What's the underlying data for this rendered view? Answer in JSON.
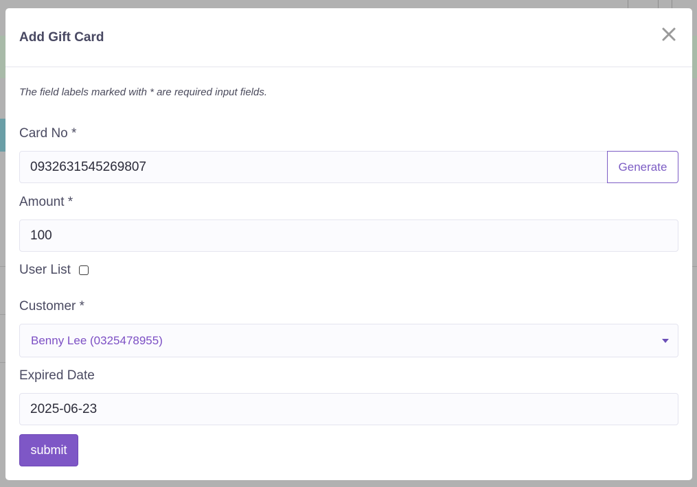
{
  "modal": {
    "title": "Add Gift Card",
    "close_icon": "close-icon",
    "note": "The field labels marked with * are required input fields.",
    "fields": {
      "card_no": {
        "label": "Card No *",
        "value": "0932631545269807",
        "generate_label": "Generate"
      },
      "amount": {
        "label": "Amount *",
        "value": "100"
      },
      "user_list": {
        "label": "User List",
        "checked": false
      },
      "customer": {
        "label": "Customer *",
        "selected": "Benny Lee (0325478955)"
      },
      "expired_date": {
        "label": "Expired Date",
        "value": "2025-06-23"
      }
    },
    "submit_label": "submit"
  },
  "colors": {
    "accent": "#7e57c6",
    "backdrop": "#b1b1b1"
  }
}
